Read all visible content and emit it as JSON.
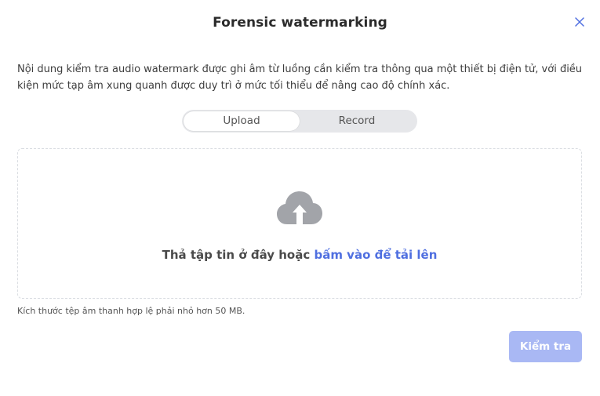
{
  "dialog": {
    "title": "Forensic watermarking",
    "description": "Nội dung kiểm tra audio watermark được ghi âm từ luồng cần kiểm tra thông qua một thiết bị điện tử, với điều kiện mức tạp âm xung quanh được duy trì ở mức tối thiểu để nâng cao độ chính xác.",
    "close_icon": "close-icon"
  },
  "mode_switch": {
    "options": [
      "Upload",
      "Record"
    ],
    "selected": "Upload"
  },
  "dropzone": {
    "icon": "cloud-upload-icon",
    "text": "Thả tập tin ở đây hoặc ",
    "link_text": "bấm vào để tải lên"
  },
  "size_note": "Kích thước tệp âm thanh hợp lệ phải nhỏ hơn 50 MB.",
  "actions": {
    "submit_label": "Kiểm tra"
  },
  "colors": {
    "accent": "#4f6fe0",
    "submit_disabled": "#a9b8f4",
    "icon_gray": "#a2a4a9"
  }
}
